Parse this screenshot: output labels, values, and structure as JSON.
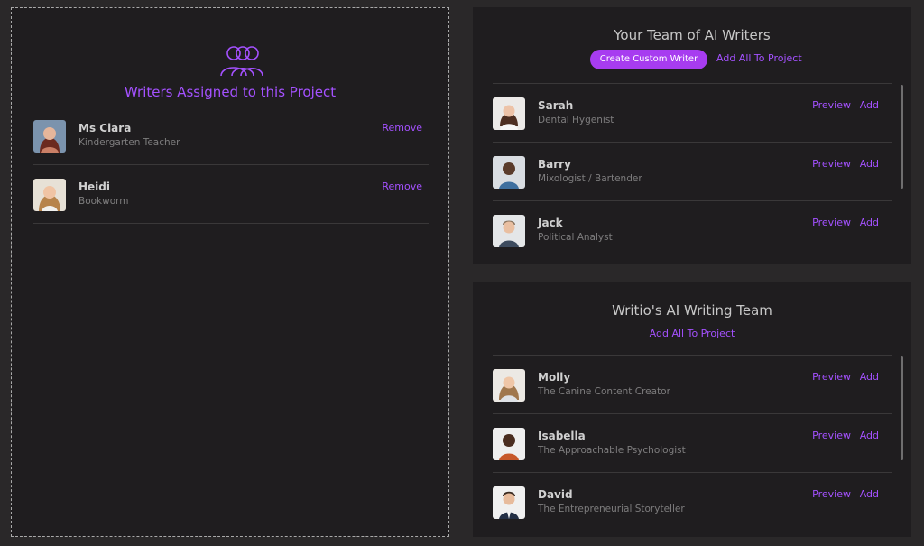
{
  "assigned": {
    "title": "Writers Assigned to this Project",
    "icon": "group-icon",
    "writers": [
      {
        "name": "Ms Clara",
        "role": "Kindergarten Teacher",
        "action": "Remove",
        "avatar": "clara-avatar"
      },
      {
        "name": "Heidi",
        "role": "Bookworm",
        "action": "Remove",
        "avatar": "heidi-avatar"
      }
    ]
  },
  "team": {
    "title": "Your Team of AI Writers",
    "create_label": "Create Custom Writer",
    "add_all_label": "Add All To Project",
    "writers": [
      {
        "name": "Sarah",
        "role": "Dental Hygenist",
        "preview": "Preview",
        "add": "Add"
      },
      {
        "name": "Barry",
        "role": "Mixologist / Bartender",
        "preview": "Preview",
        "add": "Add"
      },
      {
        "name": "Jack",
        "role": "Political Analyst",
        "preview": "Preview",
        "add": "Add"
      }
    ]
  },
  "writio": {
    "title": "Writio's AI Writing Team",
    "add_all_label": "Add All To Project",
    "writers": [
      {
        "name": "Molly",
        "role": "The Canine Content Creator",
        "preview": "Preview",
        "add": "Add"
      },
      {
        "name": "Isabella",
        "role": "The Approachable Psychologist",
        "preview": "Preview",
        "add": "Add"
      },
      {
        "name": "David",
        "role": "The Entrepreneurial Storyteller",
        "preview": "Preview",
        "add": "Add"
      }
    ]
  },
  "colors": {
    "accent": "#a451ff",
    "button": "#a73cf0",
    "panel": "#1f1d1f",
    "background": "#2a2829"
  }
}
